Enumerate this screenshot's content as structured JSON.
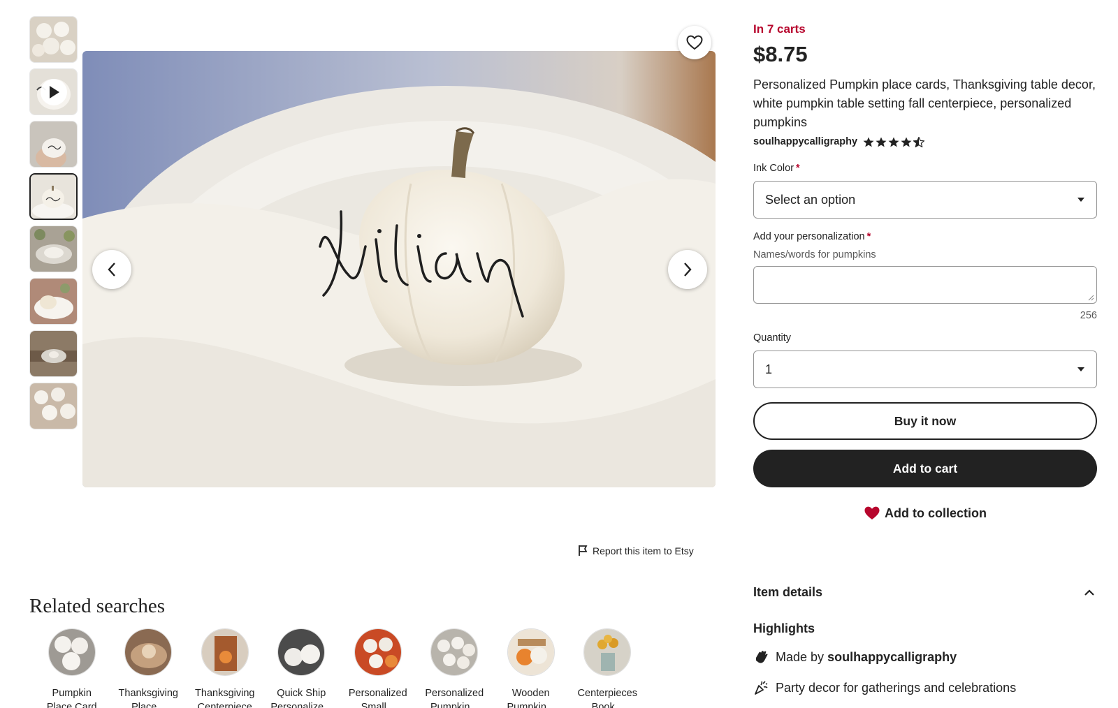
{
  "listing": {
    "in_carts": "In 7 carts",
    "price": "$8.75",
    "title": "Personalized Pumpkin place cards, Thanksgiving table decor, white pumpkin table setting fall centerpiece, personalized pumpkins",
    "seller": "soulhappycalligraphy",
    "rating": 4.5,
    "main_image_text": "julian"
  },
  "gallery": {
    "thumbnail_count": 8,
    "active_index": 3,
    "video_thumbnail_index": 1
  },
  "form": {
    "ink_color_label": "Ink Color",
    "ink_color_value": "Select an option",
    "personalization_label": "Add your personalization",
    "personalization_hint": "Names/words for pumpkins",
    "personalization_value": "",
    "char_counter": "256",
    "quantity_label": "Quantity",
    "quantity_value": "1",
    "required_mark": "*"
  },
  "actions": {
    "buy_now": "Buy it now",
    "add_to_cart": "Add to cart",
    "add_to_collection": "Add to collection",
    "report": "Report this item to Etsy"
  },
  "details": {
    "item_details": "Item details",
    "highlights": "Highlights",
    "made_by_prefix": "Made by",
    "made_by_name": "soulhappycalligraphy",
    "occasion": "Party decor for gatherings and celebrations"
  },
  "related": {
    "title": "Related searches",
    "items": [
      {
        "line1": "Pumpkin",
        "line2": "Place Card"
      },
      {
        "line1": "Thanksgiving",
        "line2": "Place..."
      },
      {
        "line1": "Thanksgiving",
        "line2": "Centerpiece"
      },
      {
        "line1": "Quick Ship",
        "line2": "Personalize..."
      },
      {
        "line1": "Personalized",
        "line2": "Small..."
      },
      {
        "line1": "Personalized",
        "line2": "Pumpkin..."
      },
      {
        "line1": "Wooden",
        "line2": "Pumpkin..."
      },
      {
        "line1": "Centerpieces",
        "line2": "Book..."
      }
    ]
  },
  "colors": {
    "accent_red": "#b7062d",
    "text": "#222222",
    "button_dark": "#222222"
  },
  "icons": {
    "favorite": "heart-outline-icon",
    "prev": "chevron-left-icon",
    "next": "chevron-right-icon",
    "report": "flag-icon",
    "collection": "heart-filled-icon",
    "dropdown": "caret-down-icon",
    "collapse": "chevron-up-icon",
    "made_by": "hand-wave-icon",
    "occasion": "party-popper-icon",
    "play": "play-icon",
    "star": "star-icon"
  }
}
